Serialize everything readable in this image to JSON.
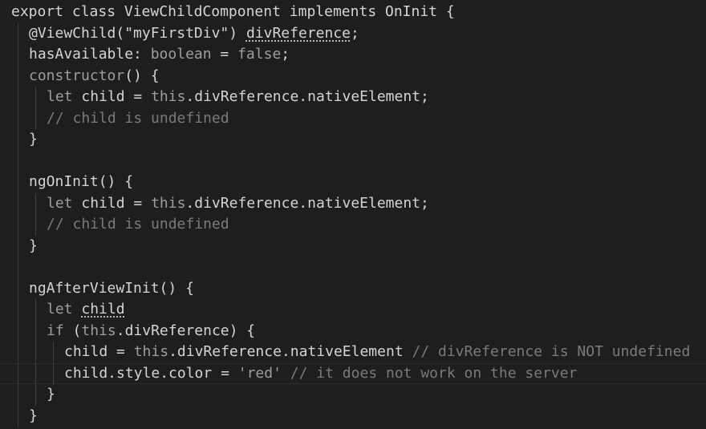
{
  "editor": {
    "colors": {
      "background": "#1e1e1e",
      "text": "#d4d4d4",
      "keyword": "#9d9d9d",
      "comment": "#7a7a7a",
      "indent_guide": "#404040"
    },
    "lines": [
      {
        "indent": 0,
        "tokens": [
          {
            "t": "export class ViewChildComponent implements OnInit {",
            "c": "white"
          }
        ]
      },
      {
        "indent": 1,
        "tokens": [
          {
            "t": "@ViewChild(\"myFirstDiv\") ",
            "c": "white"
          },
          {
            "t": "divReference",
            "c": "white",
            "squiggle": true
          },
          {
            "t": ";",
            "c": "white"
          }
        ]
      },
      {
        "indent": 1,
        "tokens": [
          {
            "t": "hasAvailable: ",
            "c": "white"
          },
          {
            "t": "boolean",
            "c": "gray"
          },
          {
            "t": " = ",
            "c": "white"
          },
          {
            "t": "false",
            "c": "gray"
          },
          {
            "t": ";",
            "c": "white"
          }
        ]
      },
      {
        "indent": 1,
        "tokens": [
          {
            "t": "constructor",
            "c": "gray"
          },
          {
            "t": "() {",
            "c": "white"
          }
        ]
      },
      {
        "indent": 2,
        "tokens": [
          {
            "t": "let",
            "c": "gray"
          },
          {
            "t": " child = ",
            "c": "white"
          },
          {
            "t": "this",
            "c": "gray"
          },
          {
            "t": ".divReference.nativeElement;",
            "c": "white"
          }
        ]
      },
      {
        "indent": 2,
        "tokens": [
          {
            "t": "// child is undefined",
            "c": "comment"
          }
        ]
      },
      {
        "indent": 1,
        "tokens": [
          {
            "t": "}",
            "c": "white"
          }
        ]
      },
      {
        "indent": 1,
        "tokens": []
      },
      {
        "indent": 1,
        "tokens": [
          {
            "t": "ngOnInit() {",
            "c": "white"
          }
        ]
      },
      {
        "indent": 2,
        "tokens": [
          {
            "t": "let",
            "c": "gray"
          },
          {
            "t": " child = ",
            "c": "white"
          },
          {
            "t": "this",
            "c": "gray"
          },
          {
            "t": ".divReference.nativeElement;",
            "c": "white"
          }
        ]
      },
      {
        "indent": 2,
        "tokens": [
          {
            "t": "// child is undefined",
            "c": "comment"
          }
        ]
      },
      {
        "indent": 1,
        "tokens": [
          {
            "t": "}",
            "c": "white"
          }
        ]
      },
      {
        "indent": 1,
        "tokens": []
      },
      {
        "indent": 1,
        "tokens": [
          {
            "t": "ngAfterViewInit() {",
            "c": "white"
          }
        ]
      },
      {
        "indent": 2,
        "tokens": [
          {
            "t": "let",
            "c": "gray"
          },
          {
            "t": " ",
            "c": "white"
          },
          {
            "t": "child",
            "c": "white",
            "squiggle": true
          }
        ]
      },
      {
        "indent": 2,
        "tokens": [
          {
            "t": "if",
            "c": "gray"
          },
          {
            "t": " (",
            "c": "white"
          },
          {
            "t": "this",
            "c": "gray"
          },
          {
            "t": ".divReference) {",
            "c": "white"
          }
        ]
      },
      {
        "indent": 3,
        "tokens": [
          {
            "t": "child = ",
            "c": "white"
          },
          {
            "t": "this",
            "c": "gray"
          },
          {
            "t": ".divReference.nativeElement ",
            "c": "white"
          },
          {
            "t": "// divReference is NOT undefined",
            "c": "comment"
          }
        ]
      },
      {
        "indent": 3,
        "highlight": true,
        "tokens": [
          {
            "t": "child.style.color = ",
            "c": "white"
          },
          {
            "t": "'red'",
            "c": "gray"
          },
          {
            "t": " ",
            "c": "white"
          },
          {
            "t": "// it does not work on the server",
            "c": "comment"
          }
        ]
      },
      {
        "indent": 2,
        "tokens": [
          {
            "t": "}",
            "c": "white"
          }
        ]
      },
      {
        "indent": 1,
        "tokens": [
          {
            "t": "}",
            "c": "white"
          }
        ]
      }
    ]
  }
}
